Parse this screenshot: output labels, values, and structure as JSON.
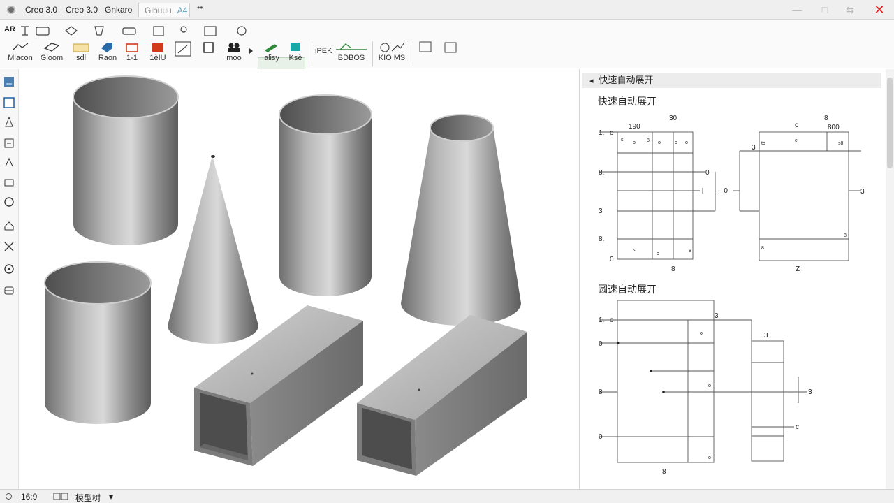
{
  "titlebar": {
    "tabs": [
      {
        "label": "Creo 3.0"
      },
      {
        "label": "Creo 3.0"
      },
      {
        "label": "Gnkaro"
      },
      {
        "label": "Gibuuu",
        "extra": "A4"
      }
    ],
    "more": "••",
    "win_min": "—",
    "win_max": "□",
    "win_restore": "⇆",
    "win_close": "✕"
  },
  "ribbon": {
    "row1_label": "AR",
    "buttons": [
      {
        "label": "Mlacon"
      },
      {
        "label": "Gloom"
      },
      {
        "label": "sdl"
      },
      {
        "label": "Raon"
      },
      {
        "label": "1-1"
      },
      {
        "label": "1èIU"
      },
      {
        "label": ""
      },
      {
        "label": ""
      },
      {
        "label": "moo"
      },
      {
        "label": "alisy"
      },
      {
        "label": "Ksè"
      },
      {
        "label": "iPEK"
      },
      {
        "label": "BDBOS"
      },
      {
        "label": "KIO MS"
      }
    ]
  },
  "panel": {
    "header": "快速自动展开",
    "header_icon": "◂",
    "section1_title": "快速自动展开",
    "section2_title": "圆速自动展开",
    "d1": {
      "top_labels": [
        "190",
        "30"
      ],
      "left_labels": [
        "1.",
        "8.",
        "3",
        "8.",
        "0"
      ],
      "left_o": "o",
      "right_labels": [
        "0",
        "– 0"
      ],
      "bottom_label": "8",
      "cell_marks": [
        "s",
        "o",
        "8",
        "o",
        "o",
        "o",
        "s",
        "o",
        "8"
      ]
    },
    "d2": {
      "top_labels": [
        "c",
        "8",
        "800"
      ],
      "left_label": "3",
      "right_label": "3",
      "bottom_label": "Z",
      "cell_marks": [
        "to",
        "c",
        "s8",
        "8",
        "8"
      ]
    },
    "d3": {
      "left_labels": [
        "1.",
        "0",
        "8",
        "0"
      ],
      "left_o": "o",
      "right_labels": [
        "3",
        "3",
        "3",
        "c"
      ],
      "bottom_label": "8",
      "cell_marks": [
        "o",
        "o",
        "o"
      ]
    }
  },
  "statusbar": {
    "ratio": "16:9",
    "view_label": "模型树",
    "dropdown_arrow": "▾"
  },
  "colors": {
    "accent_green": "#2f8a3a",
    "accent_red": "#d23a1c",
    "accent_blue": "#2b6aa8",
    "accent_teal": "#1aa7a7",
    "close_red": "#d22222"
  }
}
